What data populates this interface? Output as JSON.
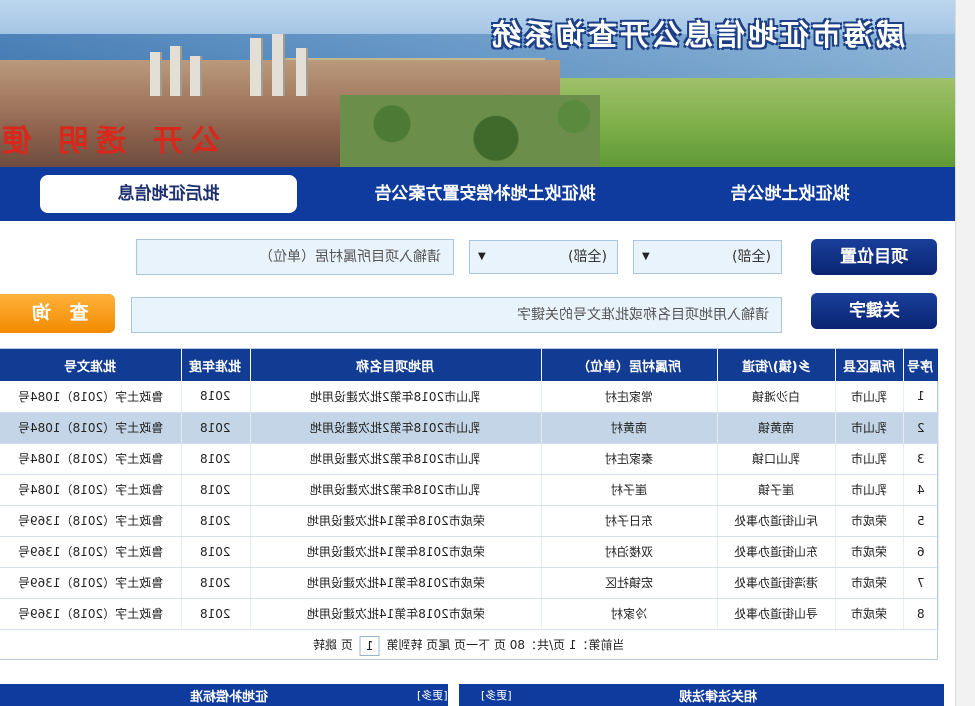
{
  "banner": {
    "title": "威海市征地信息公开查询系统",
    "slogan": "公开 透明 便"
  },
  "nav": {
    "tabs": [
      {
        "label": "批后征地信息",
        "active": true
      },
      {
        "label": "拟征收土地补偿安置方案公告",
        "active": false
      },
      {
        "label": "拟征收土地公告",
        "active": false
      }
    ]
  },
  "search": {
    "location_label": "项目位置",
    "keyword_label": "关键字",
    "county_select": "(全部)",
    "town_select": "(全部)",
    "village_placeholder": "请输入项目所属村居（单位）",
    "keyword_placeholder": "请输入用地项目名称或批准文号的关键字",
    "query_button": "查 询"
  },
  "table": {
    "headers": [
      "序号",
      "所属区县",
      "乡(镇)/街道",
      "所属村居（单位）",
      "用地项目名称",
      "批准年度",
      "批准文号"
    ],
    "rows": [
      [
        "1",
        "乳山市",
        "白沙滩镇",
        "常家庄村",
        "乳山市2018年第2批次建设用地",
        "2018",
        "鲁政土字（2018）1084号"
      ],
      [
        "2",
        "乳山市",
        "南黄镇",
        "南黄村",
        "乳山市2018年第2批次建设用地",
        "2018",
        "鲁政土字（2018）1084号"
      ],
      [
        "3",
        "乳山市",
        "乳山口镇",
        "秦家庄村",
        "乳山市2018年第2批次建设用地",
        "2018",
        "鲁政土字（2018）1084号"
      ],
      [
        "4",
        "乳山市",
        "崖子镇",
        "崖子村",
        "乳山市2018年第2批次建设用地",
        "2018",
        "鲁政土字（2018）1084号"
      ],
      [
        "5",
        "荣成市",
        "斥山街道办事处",
        "东日子村",
        "荣成市2018年第14批次建设用地",
        "2018",
        "鲁政土字（2018）1369号"
      ],
      [
        "6",
        "荣成市",
        "东山街道办事处",
        "双楼泊村",
        "荣成市2018年第14批次建设用地",
        "2018",
        "鲁政土字（2018）1369号"
      ],
      [
        "7",
        "荣成市",
        "港湾街道办事处",
        "宏镇社区",
        "荣成市2018年第14批次建设用地",
        "2018",
        "鲁政土字（2018）1369号"
      ],
      [
        "8",
        "荣成市",
        "寻山街道办事处",
        "冷家村",
        "荣成市2018年第14批次建设用地",
        "2018",
        "鲁政土字（2018）1369号"
      ]
    ],
    "selected_row": 2
  },
  "pager": {
    "text_before": "当前第：1 页/共：80 页 下一页 尾页 转到第",
    "page_input": "1",
    "text_after": "页 跳转"
  },
  "bottom": {
    "left_title": "征地补偿标准",
    "left_more": "[更多]",
    "right_title": "相关法律法规",
    "right_more": "[更多]"
  },
  "colors": {
    "nav_blue": "#0f3a9e",
    "query_orange": "#f28a00",
    "selected_row": "#c3d5e6"
  }
}
